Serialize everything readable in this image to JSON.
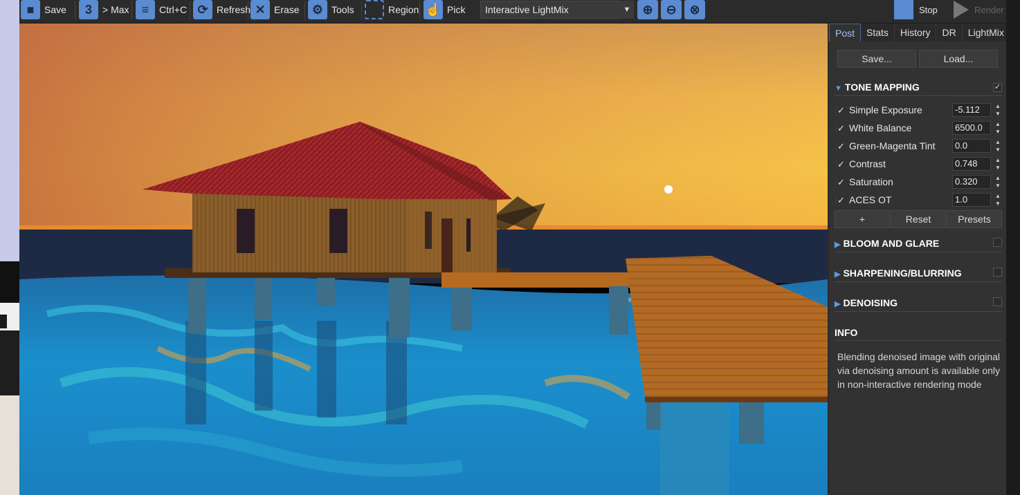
{
  "toolbar": {
    "save_label": "Save",
    "max_label": "> Max",
    "copy_label": "Ctrl+C",
    "refresh_label": "Refresh",
    "erase_label": "Erase",
    "tools_label": "Tools",
    "region_label": "Region",
    "pick_label": "Pick",
    "mode_value": "Interactive LightMix",
    "stop_label": "Stop",
    "render_label": "Render"
  },
  "panel": {
    "tabs": [
      "Post",
      "Stats",
      "History",
      "DR",
      "LightMix"
    ],
    "active_tab": "Post",
    "save_button": "Save...",
    "load_button": "Load...",
    "tone_mapping": {
      "title": "TONE MAPPING",
      "enabled": true,
      "rows": [
        {
          "label": "Simple Exposure",
          "value": "-5.112",
          "checked": true
        },
        {
          "label": "White Balance",
          "value": "6500.0",
          "checked": true
        },
        {
          "label": "Green-Magenta Tint",
          "value": "0.0",
          "checked": true
        },
        {
          "label": "Contrast",
          "value": "0.748",
          "checked": true
        },
        {
          "label": "Saturation",
          "value": "0.320",
          "checked": true
        },
        {
          "label": "ACES OT",
          "value": "1.0",
          "checked": true
        }
      ],
      "add_label": "+",
      "reset_label": "Reset",
      "presets_label": "Presets"
    },
    "bloom_title": "BLOOM AND GLARE",
    "sharpen_title": "SHARPENING/BLURRING",
    "denoise_title": "DENOISING",
    "info_title": "INFO",
    "info_text": "Blending denoised image with original via denoising amount is available only in non-interactive rendering mode"
  },
  "colors": {
    "accent": "#5b8bd0",
    "panel_bg": "#323232",
    "tab_active": "#9fc3f0"
  }
}
